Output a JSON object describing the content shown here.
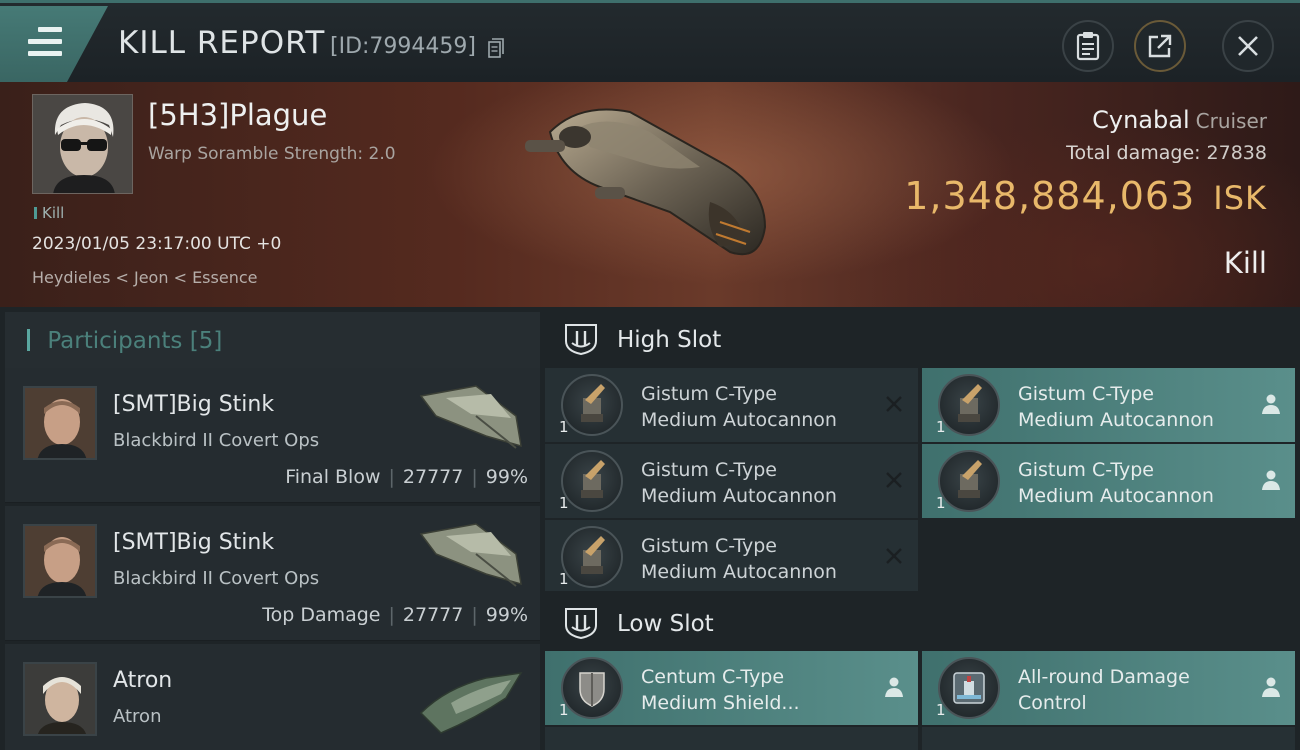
{
  "header": {
    "title": "KILL REPORT",
    "kill_id": "[ID:7994459]"
  },
  "victim": {
    "name": "[5H3]Plague",
    "scramble": "Warp Soramble Strength: 2.0",
    "tag": "Kill",
    "timestamp": "2023/01/05 23:17:00 UTC +0",
    "location": "Heydieles < Jeon < Essence",
    "ship_name": "Cynabal",
    "ship_class": "Cruiser",
    "total_damage_label": "Total damage:",
    "total_damage": "27838",
    "isk_value": "1,348,884,063",
    "isk_unit": "ISK",
    "result": "Kill"
  },
  "participants": {
    "label": "Participants",
    "count": "[5]",
    "items": [
      {
        "name": "[SMT]Big Stink",
        "ship": "Blackbird II Covert Ops",
        "role": "Final Blow",
        "damage": "27777",
        "percent": "99%"
      },
      {
        "name": "[SMT]Big Stink",
        "ship": "Blackbird II Covert Ops",
        "role": "Top Damage",
        "damage": "27777",
        "percent": "99%"
      },
      {
        "name": "Atron",
        "ship": "Atron"
      }
    ]
  },
  "fitting": {
    "high_label": "High Slot",
    "low_label": "Low Slot",
    "high": [
      {
        "line1": "Gistum C-Type",
        "line2": "Medium Autocannon",
        "qty": "1",
        "state": "destroyed-icon"
      },
      {
        "line1": "Gistum C-Type",
        "line2": "Medium Autocannon",
        "qty": "1",
        "state": "dropped-icon"
      },
      {
        "line1": "Gistum C-Type",
        "line2": "Medium Autocannon",
        "qty": "1",
        "state": "destroyed-icon"
      },
      {
        "line1": "Gistum C-Type",
        "line2": "Medium Autocannon",
        "qty": "1",
        "state": "dropped-icon"
      },
      {
        "line1": "Gistum C-Type",
        "line2": "Medium Autocannon",
        "qty": "1",
        "state": "destroyed-icon"
      }
    ],
    "low": [
      {
        "line1": "Centum C-Type",
        "line2": "Medium Shield...",
        "qty": "1",
        "state": "dropped-icon"
      },
      {
        "line1": "All-round Damage",
        "line2": "Control",
        "qty": "1",
        "state": "dropped-icon"
      }
    ]
  },
  "colors": {
    "accent": "#4f9b95",
    "isk": "#e8b86a",
    "dropped_bg": "#4d817d"
  }
}
